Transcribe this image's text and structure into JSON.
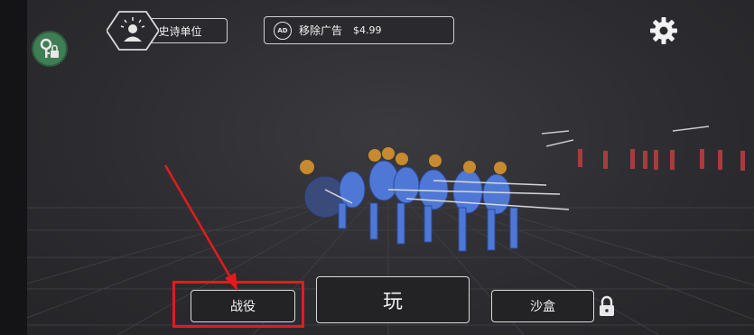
{
  "header": {
    "epic_units_label": "史诗单位",
    "remove_ads_label": "移除广告",
    "remove_ads_price": "$4.99",
    "ad_badge_text": "AD"
  },
  "footer": {
    "campaign_label": "战役",
    "play_label": "玩",
    "sandbox_label": "沙盒"
  },
  "icons": {
    "top_left": "key-lock-icon",
    "epic": "epic-unit-icon",
    "ad": "no-ads-icon",
    "settings": "gear-icon",
    "sandbox_lock": "lock-icon"
  },
  "colors": {
    "background": "#2c2c30",
    "key_button": "#3f7d55",
    "highlight": "#e41b1b",
    "blue_army": "#4f78d6",
    "red_army": "#a83c3c"
  }
}
